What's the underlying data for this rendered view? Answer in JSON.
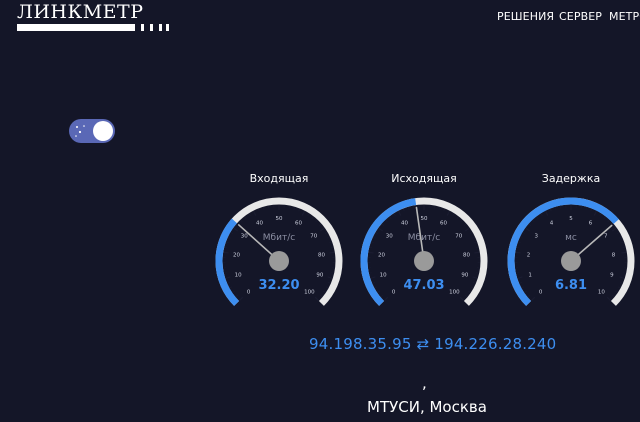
{
  "header": {
    "logo_text": "ЛИНКМЕТР",
    "nav": [
      {
        "label": "РЕШЕНИЯ"
      },
      {
        "label": "СЕРВЕР"
      },
      {
        "label": "МЕТРО"
      }
    ]
  },
  "theme_toggle": {
    "state": "on"
  },
  "gauges": [
    {
      "title": "Входящая",
      "unit": "Мбит/с",
      "value_text": "32.20",
      "value": 32.2,
      "max": 100,
      "ticks": [
        "0",
        "10",
        "20",
        "30",
        "40",
        "50",
        "60",
        "70",
        "80",
        "90",
        "100"
      ]
    },
    {
      "title": "Исходящая",
      "unit": "Мбит/с",
      "value_text": "47.03",
      "value": 47.03,
      "max": 100,
      "ticks": [
        "0",
        "10",
        "20",
        "30",
        "40",
        "50",
        "60",
        "70",
        "80",
        "90",
        "100"
      ]
    },
    {
      "title": "Задержка",
      "unit": "мс",
      "value_text": "6.81",
      "value": 6.81,
      "max": 10,
      "ticks": [
        "0",
        "1",
        "2",
        "3",
        "4",
        "5",
        "6",
        "7",
        "8",
        "9",
        "10"
      ]
    }
  ],
  "connection": {
    "client_ip": "94.198.35.95",
    "arrow": "⇄",
    "server_ip": "194.226.28.240"
  },
  "server_location": {
    "separator": ",",
    "text": "МТУСИ, Москва"
  },
  "colors": {
    "background": "#141628",
    "accent": "#3d8ef0",
    "toggle": "#5a68b6",
    "gauge_track": "#e8e8e8",
    "hub": "#9a9a9a"
  }
}
